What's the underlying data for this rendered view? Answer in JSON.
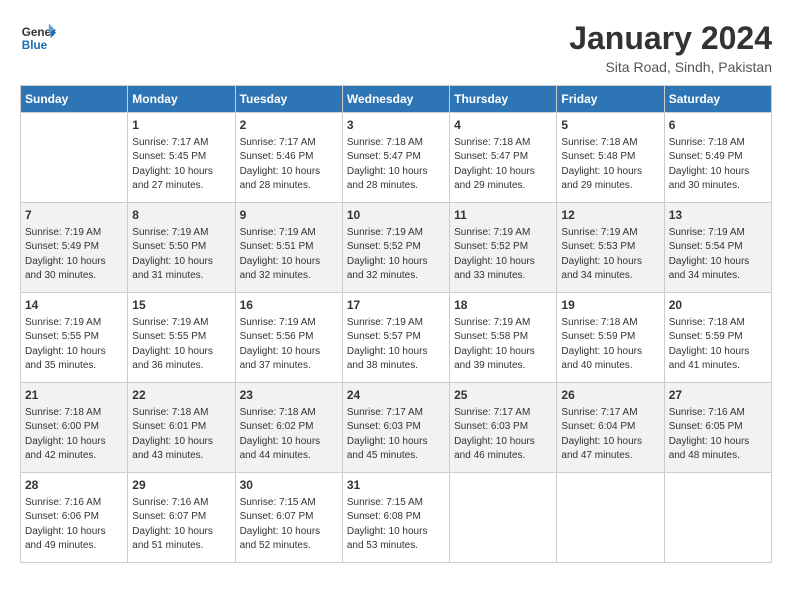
{
  "header": {
    "logo_line1": "General",
    "logo_line2": "Blue",
    "month": "January 2024",
    "location": "Sita Road, Sindh, Pakistan"
  },
  "weekdays": [
    "Sunday",
    "Monday",
    "Tuesday",
    "Wednesday",
    "Thursday",
    "Friday",
    "Saturday"
  ],
  "rows": [
    [
      {
        "day": "",
        "info": ""
      },
      {
        "day": "1",
        "info": "Sunrise: 7:17 AM\nSunset: 5:45 PM\nDaylight: 10 hours\nand 27 minutes."
      },
      {
        "day": "2",
        "info": "Sunrise: 7:17 AM\nSunset: 5:46 PM\nDaylight: 10 hours\nand 28 minutes."
      },
      {
        "day": "3",
        "info": "Sunrise: 7:18 AM\nSunset: 5:47 PM\nDaylight: 10 hours\nand 28 minutes."
      },
      {
        "day": "4",
        "info": "Sunrise: 7:18 AM\nSunset: 5:47 PM\nDaylight: 10 hours\nand 29 minutes."
      },
      {
        "day": "5",
        "info": "Sunrise: 7:18 AM\nSunset: 5:48 PM\nDaylight: 10 hours\nand 29 minutes."
      },
      {
        "day": "6",
        "info": "Sunrise: 7:18 AM\nSunset: 5:49 PM\nDaylight: 10 hours\nand 30 minutes."
      }
    ],
    [
      {
        "day": "7",
        "info": "Sunrise: 7:19 AM\nSunset: 5:49 PM\nDaylight: 10 hours\nand 30 minutes."
      },
      {
        "day": "8",
        "info": "Sunrise: 7:19 AM\nSunset: 5:50 PM\nDaylight: 10 hours\nand 31 minutes."
      },
      {
        "day": "9",
        "info": "Sunrise: 7:19 AM\nSunset: 5:51 PM\nDaylight: 10 hours\nand 32 minutes."
      },
      {
        "day": "10",
        "info": "Sunrise: 7:19 AM\nSunset: 5:52 PM\nDaylight: 10 hours\nand 32 minutes."
      },
      {
        "day": "11",
        "info": "Sunrise: 7:19 AM\nSunset: 5:52 PM\nDaylight: 10 hours\nand 33 minutes."
      },
      {
        "day": "12",
        "info": "Sunrise: 7:19 AM\nSunset: 5:53 PM\nDaylight: 10 hours\nand 34 minutes."
      },
      {
        "day": "13",
        "info": "Sunrise: 7:19 AM\nSunset: 5:54 PM\nDaylight: 10 hours\nand 34 minutes."
      }
    ],
    [
      {
        "day": "14",
        "info": "Sunrise: 7:19 AM\nSunset: 5:55 PM\nDaylight: 10 hours\nand 35 minutes."
      },
      {
        "day": "15",
        "info": "Sunrise: 7:19 AM\nSunset: 5:55 PM\nDaylight: 10 hours\nand 36 minutes."
      },
      {
        "day": "16",
        "info": "Sunrise: 7:19 AM\nSunset: 5:56 PM\nDaylight: 10 hours\nand 37 minutes."
      },
      {
        "day": "17",
        "info": "Sunrise: 7:19 AM\nSunset: 5:57 PM\nDaylight: 10 hours\nand 38 minutes."
      },
      {
        "day": "18",
        "info": "Sunrise: 7:19 AM\nSunset: 5:58 PM\nDaylight: 10 hours\nand 39 minutes."
      },
      {
        "day": "19",
        "info": "Sunrise: 7:18 AM\nSunset: 5:59 PM\nDaylight: 10 hours\nand 40 minutes."
      },
      {
        "day": "20",
        "info": "Sunrise: 7:18 AM\nSunset: 5:59 PM\nDaylight: 10 hours\nand 41 minutes."
      }
    ],
    [
      {
        "day": "21",
        "info": "Sunrise: 7:18 AM\nSunset: 6:00 PM\nDaylight: 10 hours\nand 42 minutes."
      },
      {
        "day": "22",
        "info": "Sunrise: 7:18 AM\nSunset: 6:01 PM\nDaylight: 10 hours\nand 43 minutes."
      },
      {
        "day": "23",
        "info": "Sunrise: 7:18 AM\nSunset: 6:02 PM\nDaylight: 10 hours\nand 44 minutes."
      },
      {
        "day": "24",
        "info": "Sunrise: 7:17 AM\nSunset: 6:03 PM\nDaylight: 10 hours\nand 45 minutes."
      },
      {
        "day": "25",
        "info": "Sunrise: 7:17 AM\nSunset: 6:03 PM\nDaylight: 10 hours\nand 46 minutes."
      },
      {
        "day": "26",
        "info": "Sunrise: 7:17 AM\nSunset: 6:04 PM\nDaylight: 10 hours\nand 47 minutes."
      },
      {
        "day": "27",
        "info": "Sunrise: 7:16 AM\nSunset: 6:05 PM\nDaylight: 10 hours\nand 48 minutes."
      }
    ],
    [
      {
        "day": "28",
        "info": "Sunrise: 7:16 AM\nSunset: 6:06 PM\nDaylight: 10 hours\nand 49 minutes."
      },
      {
        "day": "29",
        "info": "Sunrise: 7:16 AM\nSunset: 6:07 PM\nDaylight: 10 hours\nand 51 minutes."
      },
      {
        "day": "30",
        "info": "Sunrise: 7:15 AM\nSunset: 6:07 PM\nDaylight: 10 hours\nand 52 minutes."
      },
      {
        "day": "31",
        "info": "Sunrise: 7:15 AM\nSunset: 6:08 PM\nDaylight: 10 hours\nand 53 minutes."
      },
      {
        "day": "",
        "info": ""
      },
      {
        "day": "",
        "info": ""
      },
      {
        "day": "",
        "info": ""
      }
    ]
  ]
}
